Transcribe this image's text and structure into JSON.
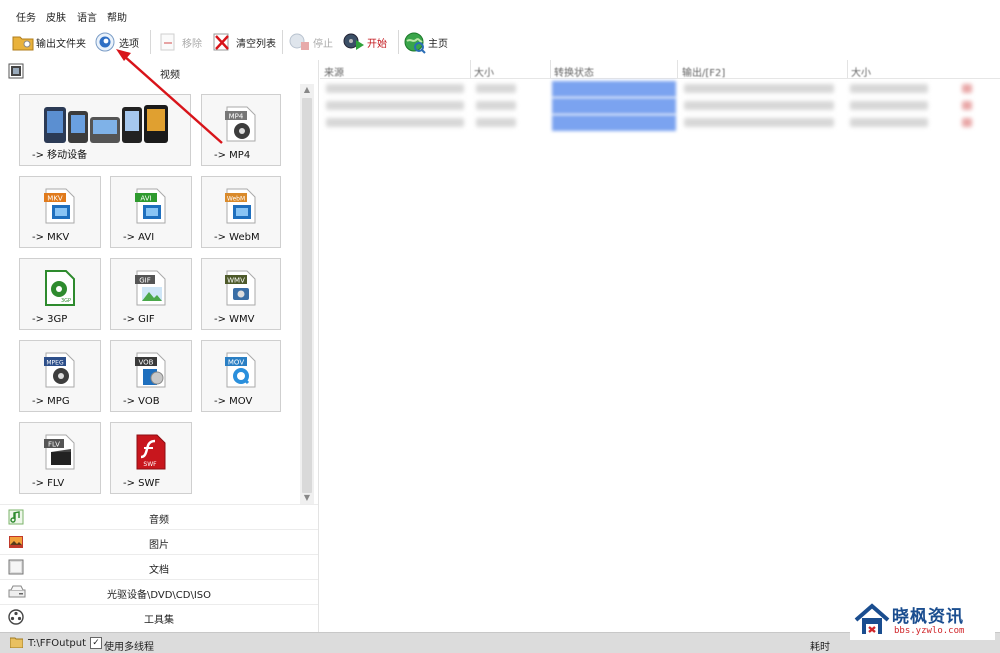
{
  "menu": {
    "items": [
      "任务",
      "皮肤",
      "语言",
      "帮助"
    ]
  },
  "toolbar": {
    "output_folder": "输出文件夹",
    "options": "选项",
    "remove": "移除",
    "clear_list": "清空列表",
    "stop": "停止",
    "start": "开始",
    "home": "主页"
  },
  "left": {
    "video_header": "视频",
    "tiles": [
      "-> 移动设备",
      "-> MP4",
      "-> MKV",
      "-> AVI",
      "-> WebM",
      "-> 3GP",
      "-> GIF",
      "-> WMV",
      "-> MPG",
      "-> VOB",
      "-> MOV",
      "-> FLV",
      "-> SWF"
    ],
    "badges": {
      "mp4": "MP4",
      "mkv": "MKV",
      "avi": "AVI",
      "webm": "WebM",
      "gif": "GIF",
      "wmv": "WMV",
      "mpg": "MPEG",
      "vob": "VOB",
      "mov": "MOV",
      "flv": "FLV",
      "swf": "SWF",
      "threegp": "3GP"
    },
    "categories": [
      "音频",
      "图片",
      "文档",
      "光驱设备\\DVD\\CD\\ISO",
      "工具集"
    ]
  },
  "table": {
    "headers": [
      "来源",
      "大小",
      "转换状态",
      "输出/[F2]",
      "大小"
    ]
  },
  "status": {
    "path": "T:\\FFOutput",
    "multithread": "使用多线程",
    "time_label": "耗时"
  },
  "watermark": {
    "title": "晓枫资讯",
    "url": "bbs.yzwlo.com"
  },
  "colors": {
    "accent_red": "#d8141a",
    "progress_blue": "#7ba3f0",
    "watermark_blue": "#1a4d8f"
  }
}
